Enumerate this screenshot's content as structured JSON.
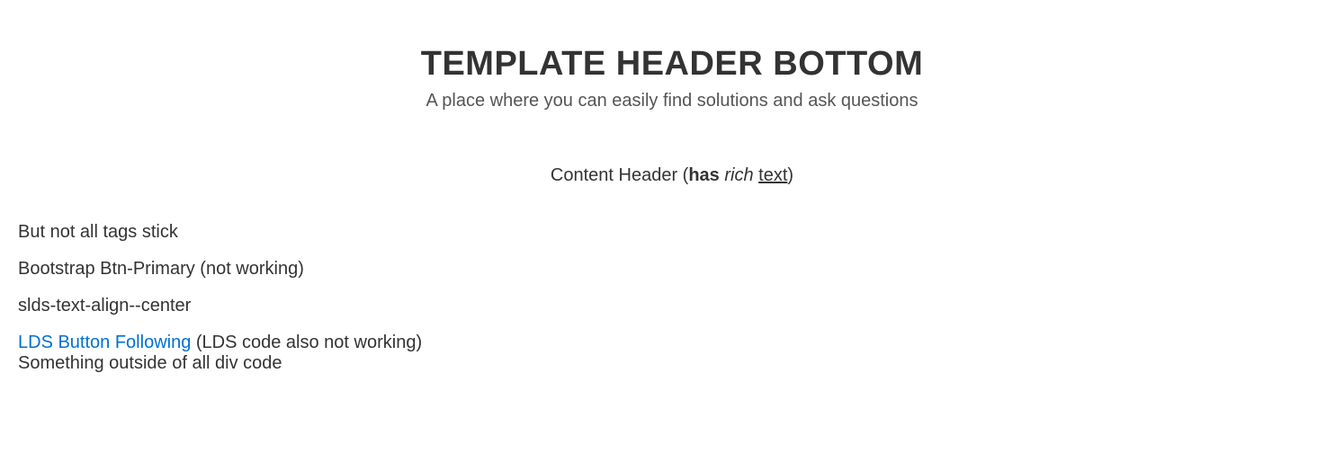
{
  "header": {
    "title": "TEMPLATE HEADER BOTTOM",
    "subtitle": "A place where you can easily find solutions and ask questions"
  },
  "content_header": {
    "prefix": "Content Header (",
    "bold": "has",
    "space1": " ",
    "italic": "rich",
    "space2": " ",
    "underline": "text",
    "suffix": ")"
  },
  "body": {
    "line1": "But not all tags stick",
    "line2": "Bootstrap Btn-Primary (not working)",
    "line3": "slds-text-align--center",
    "line4_link": "LDS Button Following",
    "line4_paren": " (LDS code also not working)",
    "line5": "Something outside of all div code"
  }
}
